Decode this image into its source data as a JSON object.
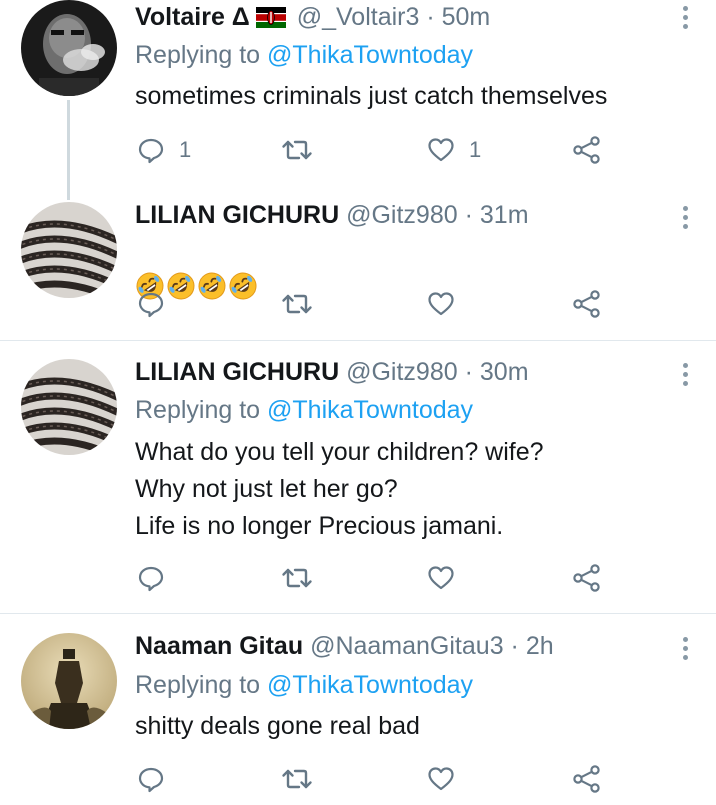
{
  "colors": {
    "link": "#1da1f2",
    "muted": "#657786",
    "text": "#14171a",
    "divider": "#e1e8ed",
    "emoji_yellow": "#fbbf2a"
  },
  "tweets": [
    {
      "name": "Voltaire Δ",
      "flag": "kenya-flag",
      "handle": "@_Voltair3",
      "dot": "·",
      "time": "50m",
      "replying_prefix": "Replying to",
      "replying_to": "@ThikaTowntoday",
      "text": "sometimes criminals just catch themselves",
      "reply_count": "1",
      "like_count": "1"
    },
    {
      "name": "LILIAN GICHURU",
      "handle": "@Gitz980",
      "dot": "·",
      "time": "31m",
      "emoji": "rolling-on-the-floor-laughing-emoji",
      "emoji_count": 4
    },
    {
      "name": "LILIAN GICHURU",
      "handle": "@Gitz980",
      "dot": "·",
      "time": "30m",
      "replying_prefix": "Replying to",
      "replying_to": "@ThikaTowntoday",
      "text": "What do you tell your children? wife?\nWhy not just let her go?\nLife is no longer Precious jamani."
    },
    {
      "name": "Naaman Gitau",
      "handle": "@NaamanGitau3",
      "dot": "·",
      "time": "2h",
      "replying_prefix": "Replying to",
      "replying_to": "@ThikaTowntoday",
      "text": "shitty deals gone real bad"
    }
  ],
  "icons": {
    "reply": "reply-icon",
    "retweet": "retweet-icon",
    "like": "heart-icon",
    "share": "share-icon",
    "more": "more-options-icon"
  }
}
